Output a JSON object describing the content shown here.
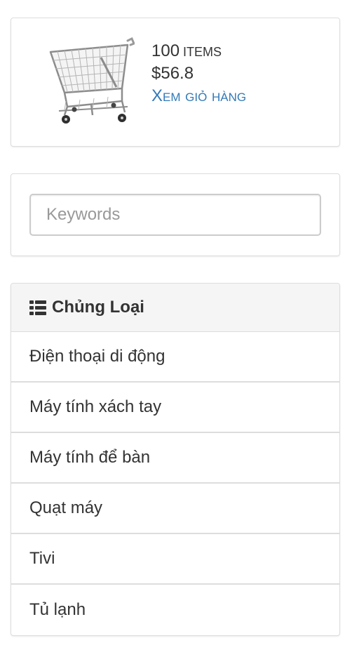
{
  "cart": {
    "count": "100",
    "items_word": "items",
    "total": "$56.8",
    "view_cart_label": "Xem giỏ hàng",
    "image_icon": "shopping-cart-image"
  },
  "search": {
    "placeholder": "Keywords",
    "value": ""
  },
  "category": {
    "icon": "list-icon",
    "title": "Chủng Loại",
    "items": [
      {
        "label": "Điện thoại di động"
      },
      {
        "label": "Máy tính xách tay"
      },
      {
        "label": "Máy tính để bàn"
      },
      {
        "label": "Quạt máy"
      },
      {
        "label": "Tivi"
      },
      {
        "label": "Tủ lạnh"
      }
    ]
  },
  "colors": {
    "link": "#337ab7",
    "text": "#333333",
    "border": "#dddddd",
    "heading_bg": "#f5f5f5"
  }
}
